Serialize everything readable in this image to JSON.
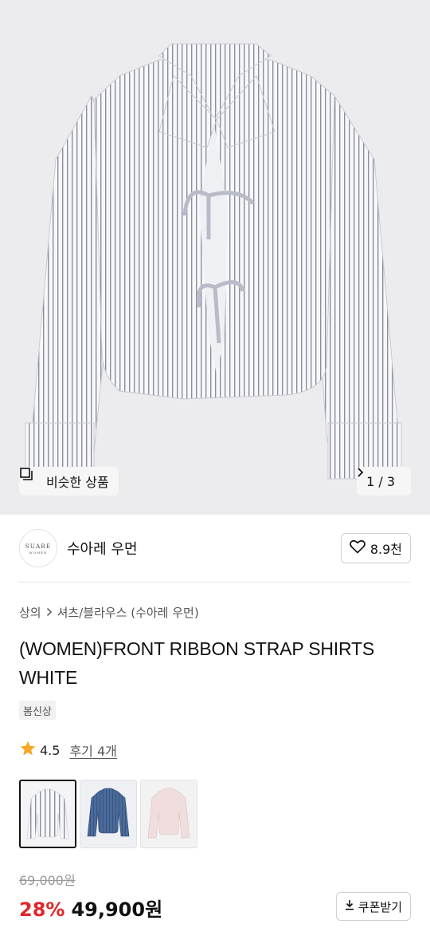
{
  "hero": {
    "similar_label": "비슷한 상품",
    "pager": "1 / 3"
  },
  "brand": {
    "logo_line1": "SUARE",
    "logo_line2": "WOMEN",
    "name": "수아레 우먼",
    "likes": "8.9천"
  },
  "breadcrumb": {
    "root": "상의",
    "sub": "셔츠/블라우스 (수아레 우먼)"
  },
  "product": {
    "title": "(WOMEN)FRONT RIBBON STRAP SHIRTS WHITE",
    "tag": "봄신상",
    "rating": "4.5",
    "reviews": "후기 4개",
    "thumbnails": [
      "white",
      "navy",
      "pink"
    ],
    "original_price": "69,000원",
    "discount": "28%",
    "price": "49,900원",
    "coupon_label": "쿠폰받기"
  },
  "colors": {
    "discount": "#e0262a",
    "star": "#f5a623"
  }
}
